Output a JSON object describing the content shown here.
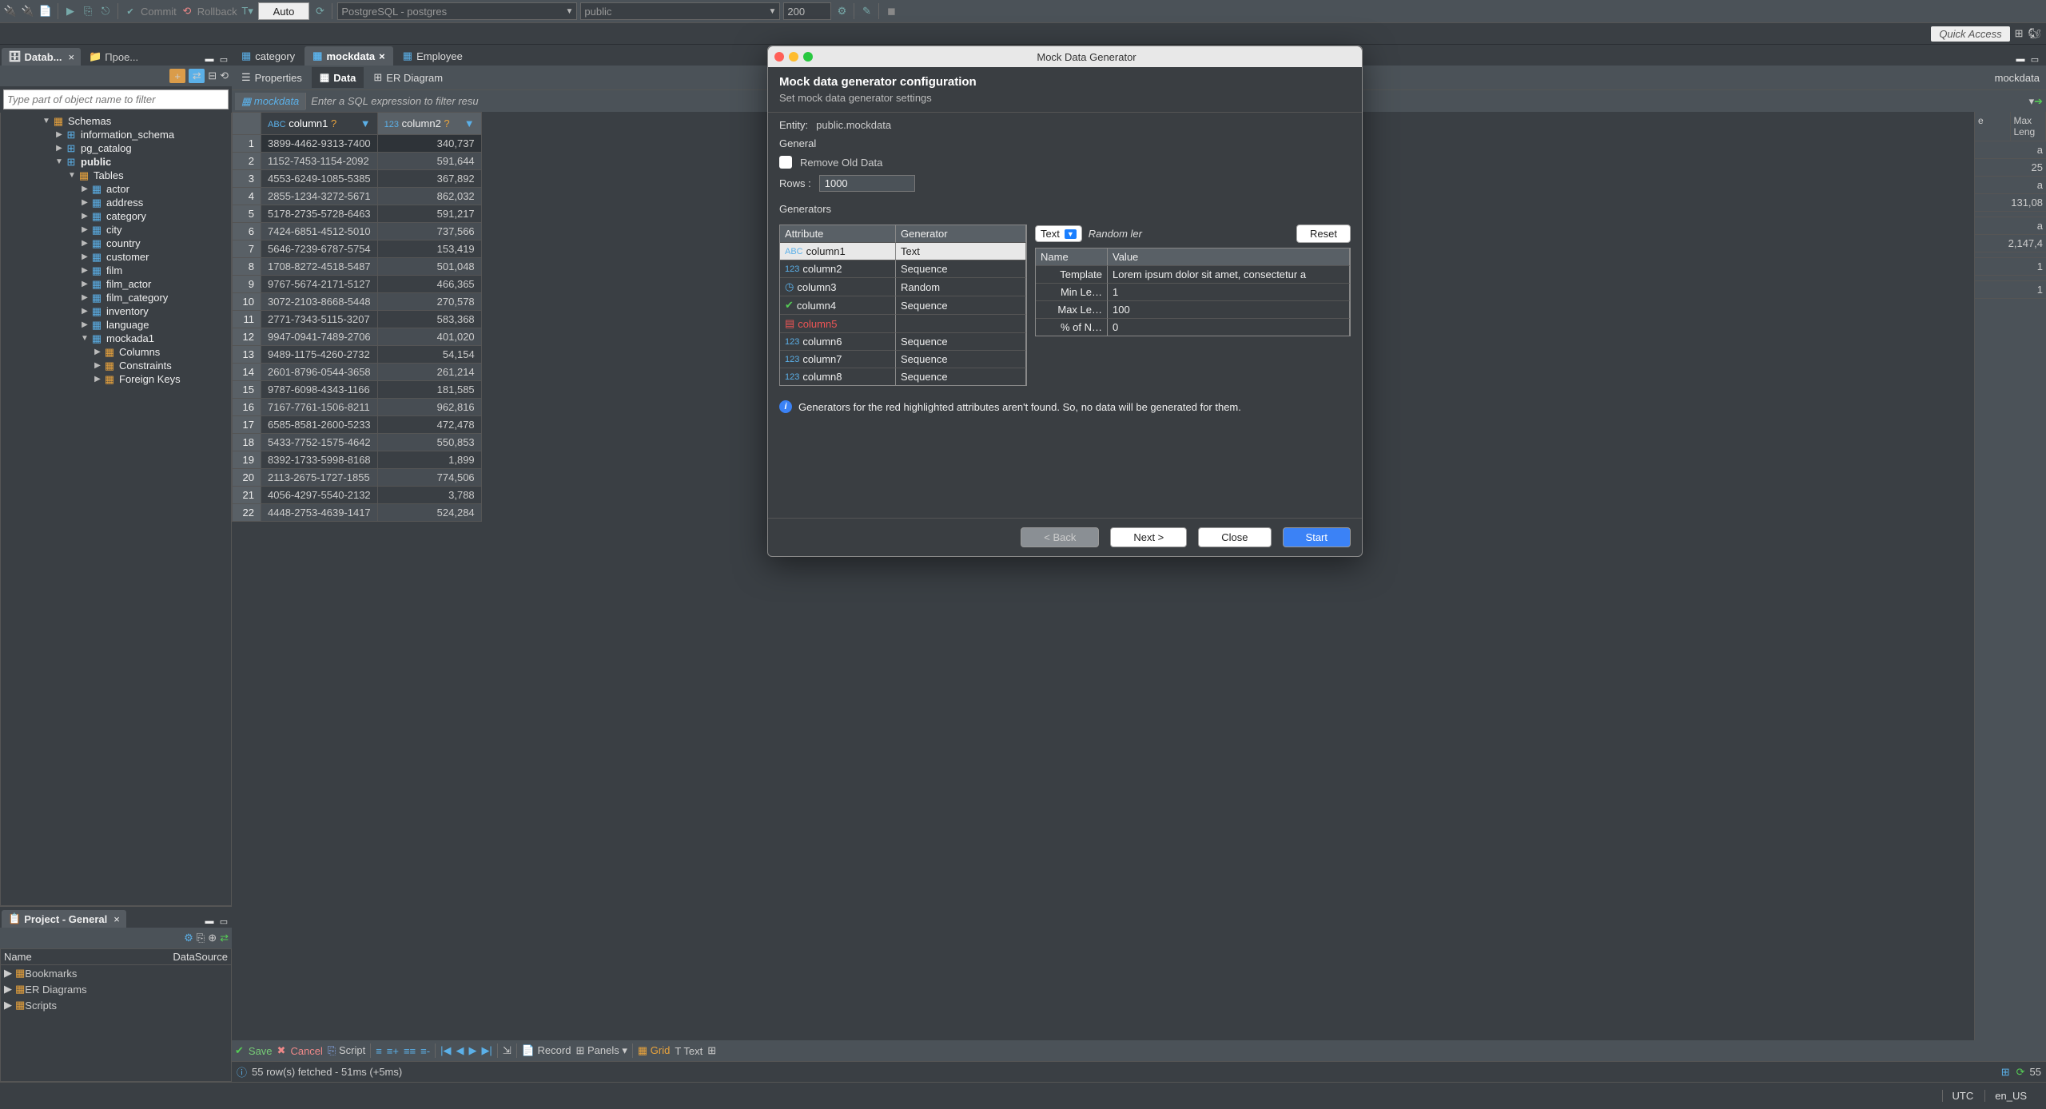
{
  "toolbar": {
    "commit": "Commit",
    "rollback": "Rollback",
    "auto": "Auto",
    "conn_combo": "PostgreSQL - postgres",
    "schema_combo": "public",
    "rows_box": "200",
    "quick_access": "Quick Access"
  },
  "left": {
    "tab_db": "Datab...",
    "tab_proj": "Прое...",
    "filter_placeholder": "Type part of object name to filter",
    "tree": {
      "schemas": "Schemas",
      "info_schema": "information_schema",
      "pg_catalog": "pg_catalog",
      "public": "public",
      "tables": "Tables",
      "items": [
        "actor",
        "address",
        "category",
        "city",
        "country",
        "customer",
        "film",
        "film_actor",
        "film_category",
        "inventory",
        "language",
        "mockada1"
      ],
      "sub": [
        "Columns",
        "Constraints",
        "Foreign Keys"
      ]
    },
    "project": {
      "title": "Project - General",
      "col_name": "Name",
      "col_ds": "DataSource",
      "bookmarks": "Bookmarks",
      "er": "ER Diagrams",
      "scripts": "Scripts"
    }
  },
  "editor": {
    "tabs": {
      "category": "category",
      "mockdata": "mockdata",
      "employee": "Employee",
      "mockdata_right": "mockdata"
    },
    "subtabs": {
      "properties": "Properties",
      "data": "Data",
      "er": "ER Diagram"
    },
    "crumb": "mockdata",
    "filter_hint": "Enter a SQL expression to filter resu",
    "col1": "column1",
    "col2": "column2",
    "rows": [
      {
        "c1": "3899-4462-9313-7400",
        "c2": "340,737"
      },
      {
        "c1": "1152-7453-1154-2092",
        "c2": "591,644"
      },
      {
        "c1": "4553-6249-1085-5385",
        "c2": "367,892"
      },
      {
        "c1": "2855-1234-3272-5671",
        "c2": "862,032"
      },
      {
        "c1": "5178-2735-5728-6463",
        "c2": "591,217"
      },
      {
        "c1": "7424-6851-4512-5010",
        "c2": "737,566"
      },
      {
        "c1": "5646-7239-6787-5754",
        "c2": "153,419"
      },
      {
        "c1": "1708-8272-4518-5487",
        "c2": "501,048"
      },
      {
        "c1": "9767-5674-2171-5127",
        "c2": "466,365"
      },
      {
        "c1": "3072-2103-8668-5448",
        "c2": "270,578"
      },
      {
        "c1": "2771-7343-5115-3207",
        "c2": "583,368"
      },
      {
        "c1": "9947-0941-7489-2706",
        "c2": "401,020"
      },
      {
        "c1": "9489-1175-4260-2732",
        "c2": "54,154"
      },
      {
        "c1": "2601-8796-0544-3658",
        "c2": "261,214"
      },
      {
        "c1": "9787-6098-4343-1166",
        "c2": "181,585"
      },
      {
        "c1": "7167-7761-1506-8211",
        "c2": "962,816"
      },
      {
        "c1": "6585-8581-2600-5233",
        "c2": "472,478"
      },
      {
        "c1": "5433-7752-1575-4642",
        "c2": "550,853"
      },
      {
        "c1": "8392-1733-5998-8168",
        "c2": "1,899"
      },
      {
        "c1": "2113-2675-1727-1855",
        "c2": "774,506"
      },
      {
        "c1": "4056-4297-5540-2132",
        "c2": "3,788"
      },
      {
        "c1": "4448-2753-4639-1417",
        "c2": "524,284"
      }
    ],
    "right_header1": "e",
    "right_header2": "Max Leng",
    "right_vals": [
      "a",
      "25",
      "a",
      "131,08",
      "",
      "a",
      "2,147,4",
      "",
      "1",
      "",
      "1"
    ],
    "bottom": {
      "save": "Save",
      "cancel": "Cancel",
      "script": "Script",
      "record": "Record",
      "panels": "Panels",
      "grid": "Grid",
      "text": "Text"
    },
    "status": {
      "fetched": "55 row(s) fetched - 51ms (+5ms)",
      "rows": "55"
    }
  },
  "global_status": {
    "tz": "UTC",
    "locale": "en_US"
  },
  "modal": {
    "title": "Mock Data Generator",
    "h1": "Mock data generator configuration",
    "h2": "Set mock data generator settings",
    "entity_lbl": "Entity:",
    "entity_val": "public.mockdata",
    "general": "General",
    "remove_old": "Remove Old Data",
    "rows_lbl": "Rows :",
    "rows_val": "1000",
    "generators": "Generators",
    "col_attr": "Attribute",
    "col_gen": "Generator",
    "gens": [
      {
        "name": "column1",
        "gen": "Text",
        "icon": "abc",
        "sel": true
      },
      {
        "name": "column2",
        "gen": "Sequence",
        "icon": "123"
      },
      {
        "name": "column3",
        "gen": "Random",
        "icon": "clock"
      },
      {
        "name": "column4",
        "gen": "Sequence",
        "icon": "check"
      },
      {
        "name": "column5",
        "gen": "",
        "icon": "doc",
        "err": true
      },
      {
        "name": "column6",
        "gen": "Sequence",
        "icon": "123"
      },
      {
        "name": "column7",
        "gen": "Sequence",
        "icon": "123"
      },
      {
        "name": "column8",
        "gen": "Sequence",
        "icon": "123"
      }
    ],
    "type_select": "Text",
    "random_ler": "Random ler",
    "reset": "Reset",
    "props_name": "Name",
    "props_value": "Value",
    "props": [
      {
        "n": "Template",
        "v": "Lorem ipsum dolor sit amet, consectetur a"
      },
      {
        "n": "Min Le…",
        "v": "1"
      },
      {
        "n": "Max Le…",
        "v": "100"
      },
      {
        "n": "% of N…",
        "v": "0"
      }
    ],
    "warn": "Generators for the red highlighted attributes aren't found. So, no data will be generated for them.",
    "back": "< Back",
    "next": "Next >",
    "close": "Close",
    "start": "Start"
  }
}
